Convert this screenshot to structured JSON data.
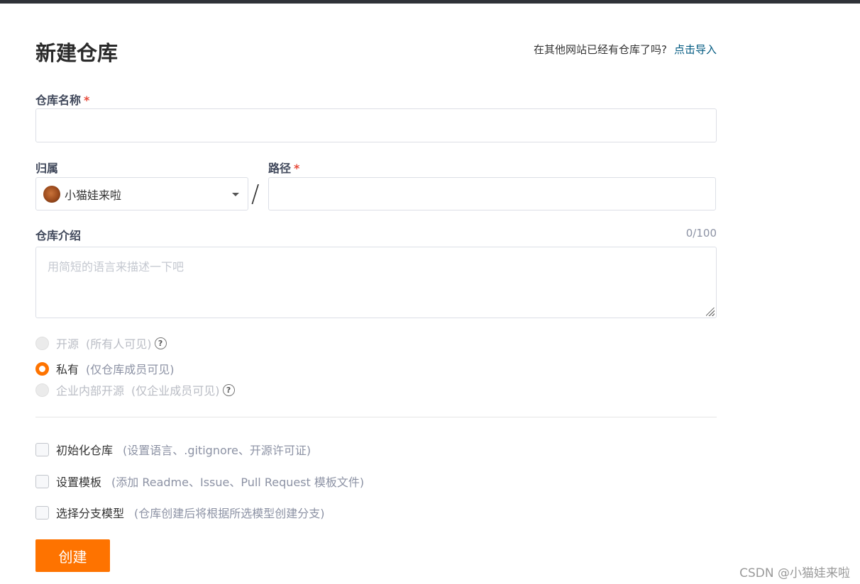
{
  "header": {
    "title": "新建仓库",
    "import_hint": "在其他网站已经有仓库了吗?",
    "import_link": "点击导入"
  },
  "form": {
    "repo_name": {
      "label": "仓库名称",
      "required_mark": "*",
      "value": ""
    },
    "owner": {
      "label": "归属",
      "selected": "小猫娃来啦"
    },
    "separator": "/",
    "path": {
      "label": "路径",
      "required_mark": "*",
      "value": ""
    },
    "description": {
      "label": "仓库介绍",
      "counter": "0/100",
      "placeholder": "用简短的语言来描述一下吧"
    },
    "visibility": [
      {
        "label": "开源",
        "note": "(所有人可见)",
        "state": "disabled",
        "help": "?"
      },
      {
        "label": "私有",
        "note": "(仅仓库成员可见)",
        "state": "checked",
        "help": ""
      },
      {
        "label": "企业内部开源",
        "note": "(仅企业成员可见)",
        "state": "disabled",
        "help": "?"
      }
    ],
    "options": [
      {
        "label": "初始化仓库",
        "note": "(设置语言、.gitignore、开源许可证)",
        "checked": false
      },
      {
        "label": "设置模板",
        "note": "(添加 Readme、Issue、Pull Request 模板文件)",
        "checked": false
      },
      {
        "label": "选择分支模型",
        "note": "(仓库创建后将根据所选模型创建分支)",
        "checked": false
      }
    ],
    "submit_label": "创建"
  },
  "watermark": "CSDN @小猫娃来啦",
  "colors": {
    "accent": "#fe7300",
    "link": "#005980",
    "required": "#e74c3c"
  }
}
